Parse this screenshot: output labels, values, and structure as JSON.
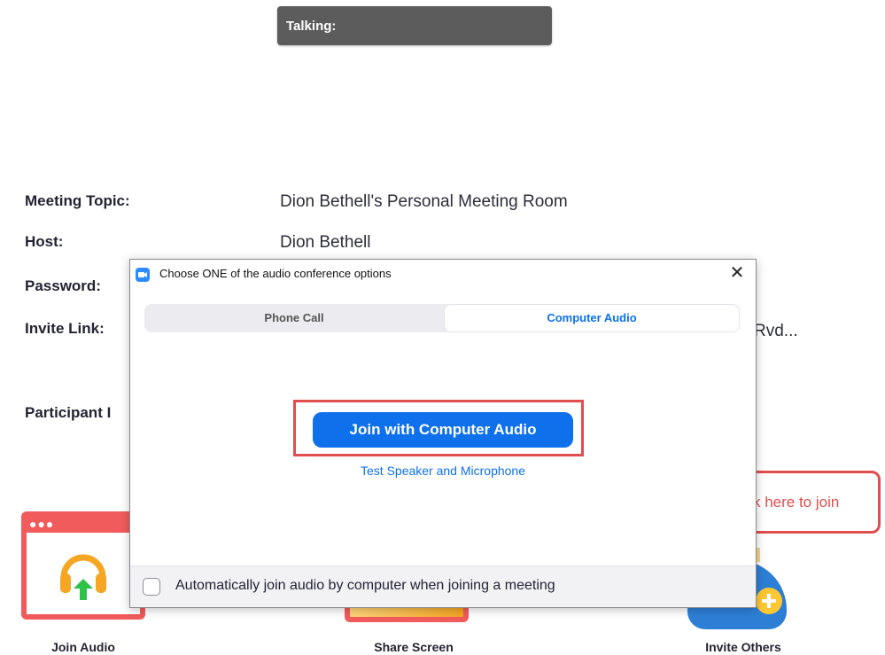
{
  "talking": {
    "label": "Talking:"
  },
  "meeting": {
    "topic_label": "Meeting Topic:",
    "topic_value": "Dion Bethell's Personal Meeting Room",
    "host_label": "Host:",
    "host_value": "Dion Bethell",
    "password_label": "Password:",
    "invite_label": "Invite Link:",
    "invite_value_tail": "Rvd...",
    "participant_label": "Participant I"
  },
  "tiles": {
    "join_audio": "Join Audio",
    "share_screen": "Share Screen",
    "invite_others": "Invite Others"
  },
  "dialog": {
    "title": "Choose ONE of the audio conference options",
    "close": "✕",
    "tabs": {
      "phone": "Phone Call",
      "computer": "Computer Audio"
    },
    "join_button": "Join with Computer Audio",
    "test_link": "Test Speaker and Microphone",
    "auto_join": "Automatically join audio by computer when joining a meeting"
  },
  "callout": {
    "text": "Click here to join"
  },
  "colors": {
    "accent": "#0e71eb",
    "highlight": "#e04e4e",
    "join_tile": "#f25b5b",
    "headphones": "#f5a623",
    "arrow": "#2ec24a"
  },
  "icons": [
    "zoom-app-icon",
    "close-icon",
    "headphones-icon",
    "arrow-up-icon",
    "plus-icon"
  ]
}
